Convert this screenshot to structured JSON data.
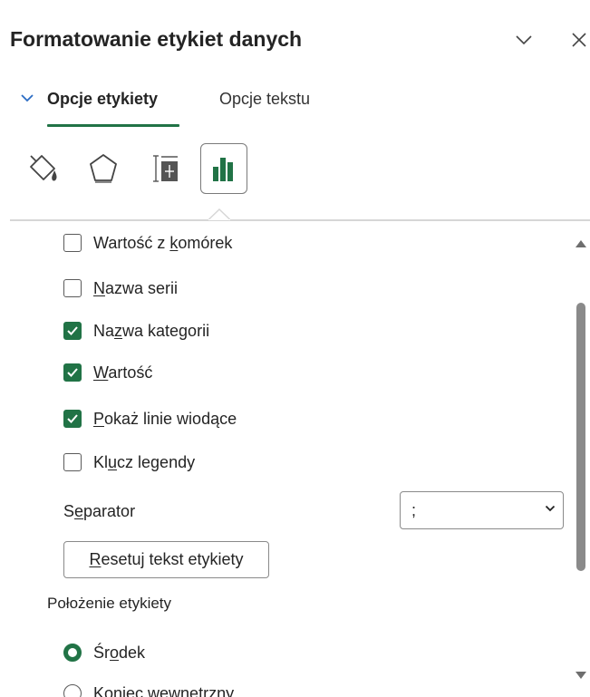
{
  "pane": {
    "title": "Formatowanie etykiet danych"
  },
  "tabs": [
    {
      "label": "Opcje etykiety",
      "active": true
    },
    {
      "label": "Opcje tekstu",
      "active": false
    }
  ],
  "categories": [
    {
      "icon": "fill-line-icon"
    },
    {
      "icon": "effects-pentagon-icon"
    },
    {
      "icon": "size-properties-icon"
    },
    {
      "icon": "label-options-bar-chart-icon",
      "selected": true
    }
  ],
  "label_contains": [
    {
      "pre": "Wartość z ",
      "u": "k",
      "post": "omórek",
      "checked": false
    },
    {
      "pre": "",
      "u": "N",
      "post": "azwa serii",
      "checked": false
    },
    {
      "pre": "Na",
      "u": "z",
      "post": "wa kategorii",
      "checked": true
    },
    {
      "pre": "",
      "u": "W",
      "post": "artość",
      "checked": true
    },
    {
      "pre": "",
      "u": "P",
      "post": "okaż linie wiodące",
      "checked": true
    },
    {
      "pre": "Kl",
      "u": "u",
      "post": "cz legendy",
      "checked": false
    }
  ],
  "separator": {
    "label_pre": "S",
    "label_u": "e",
    "label_post": "parator",
    "value": ";"
  },
  "reset_button": {
    "u": "R",
    "post": "esetuj tekst etykiety"
  },
  "label_position": {
    "heading": "Położenie etykiety",
    "options": [
      {
        "pre": "Śr",
        "u": "o",
        "post": "dek",
        "selected": true
      },
      {
        "pre": "Koniec wewnętrzny",
        "u": "",
        "post": "",
        "selected": false
      }
    ]
  },
  "colors": {
    "accent": "#217346",
    "text": "#242424",
    "border": "#8a8a8a"
  }
}
